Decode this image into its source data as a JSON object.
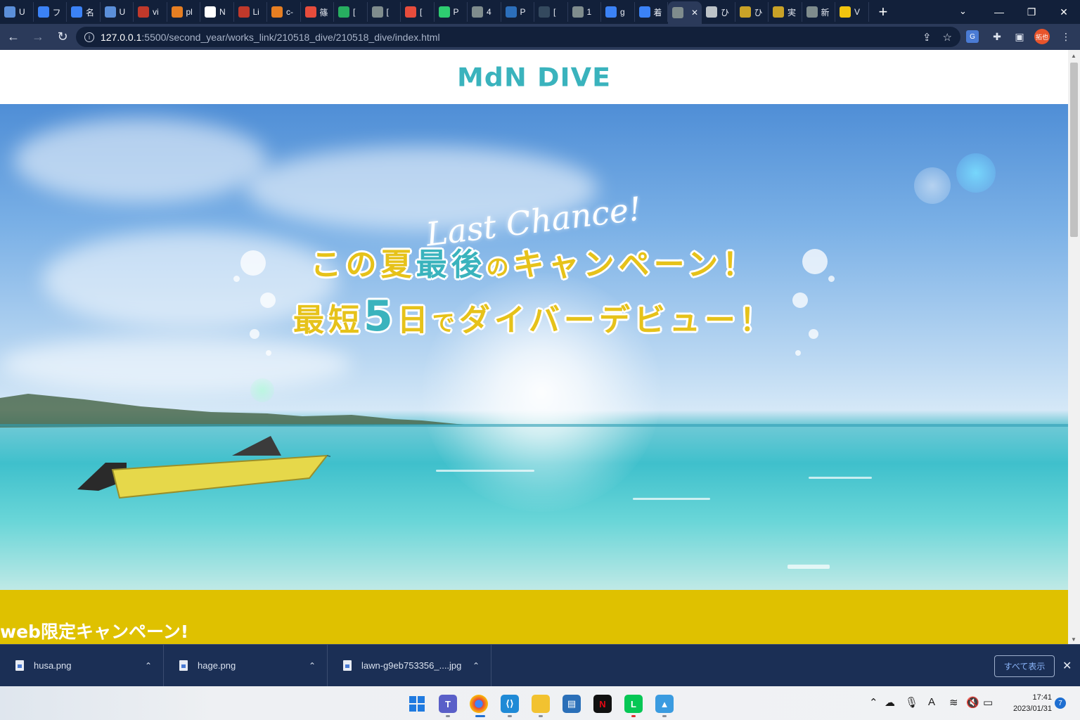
{
  "browser": {
    "tabs": [
      {
        "label": "U",
        "color": "#5b8fd9"
      },
      {
        "label": "フ",
        "color": "#3b82f6"
      },
      {
        "label": "名",
        "color": "#3b82f6"
      },
      {
        "label": "U",
        "color": "#5b8fd9"
      },
      {
        "label": "vi",
        "color": "#c0392b"
      },
      {
        "label": "pl",
        "color": "#e67e22"
      },
      {
        "label": "N",
        "color": "#ffffff"
      },
      {
        "label": "Li",
        "color": "#c0392b"
      },
      {
        "label": "c-",
        "color": "#e67e22"
      },
      {
        "label": "篠",
        "color": "#e74c3c"
      },
      {
        "label": "[",
        "color": "#27ae60"
      },
      {
        "label": "[",
        "color": "#7f8c8d"
      },
      {
        "label": "[",
        "color": "#e74c3c"
      },
      {
        "label": "P",
        "color": "#2ecc71"
      },
      {
        "label": "4",
        "color": "#7f8c8d"
      },
      {
        "label": "P",
        "color": "#2c6fbb"
      },
      {
        "label": "[",
        "color": "#34495e"
      },
      {
        "label": "1",
        "color": "#7f8c8d"
      },
      {
        "label": "g",
        "color": "#3b82f6"
      },
      {
        "label": "着",
        "color": "#3b82f6"
      },
      {
        "label": "",
        "color": "#7f8c8d",
        "active": true
      },
      {
        "label": "ひ",
        "color": "#bdc3c7"
      },
      {
        "label": "ひ",
        "color": "#c9a227"
      },
      {
        "label": "実",
        "color": "#c9a227"
      },
      {
        "label": "新",
        "color": "#7f8c8d"
      },
      {
        "label": "V",
        "color": "#f1c40f"
      }
    ],
    "active_tab_close": "✕",
    "new_tab": "+",
    "url_host": "127.0.0.1",
    "url_path": ":5500/second_year/works_link/210518_dive/210518_dive/index.html",
    "profile_label": "拓也"
  },
  "site": {
    "logo": "MdN DIVE",
    "hero_script": "Last Chance!",
    "headline_line1": {
      "a": "この夏",
      "b": "最後",
      "c": "の",
      "d": "キャンペーン！"
    },
    "headline_line2": {
      "a": "最短",
      "b": "5",
      "c": "日",
      "d": "で",
      "e": "ダイバーデビュー！"
    },
    "campaign_title": "web限定キャンペーン!"
  },
  "downloads": {
    "items": [
      "husa.png",
      "hage.png",
      "lawn-g9eb753356_....jpg"
    ],
    "show_all": "すべて表示"
  },
  "taskbar": {
    "time": "17:41",
    "date": "2023/01/31",
    "notifications": "7"
  },
  "colors": {
    "accent_teal": "#3ab3bd",
    "accent_yellow": "#dfc100"
  }
}
